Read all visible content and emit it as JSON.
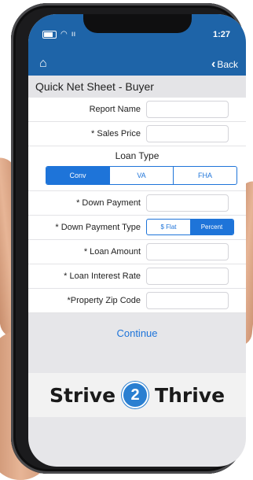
{
  "status": {
    "time": "1:27",
    "carrier": "ıı"
  },
  "nav": {
    "home_icon": "home-icon",
    "back_label": "Back"
  },
  "page": {
    "title": "Quick Net Sheet - Buyer"
  },
  "form": {
    "report_name": {
      "label": "Report Name",
      "value": ""
    },
    "sales_price": {
      "label": "* Sales Price",
      "value": ""
    },
    "loan_type": {
      "heading": "Loan Type",
      "options": [
        "Conv",
        "VA",
        "FHA"
      ],
      "selected": "Conv"
    },
    "down_payment": {
      "label": "* Down Payment",
      "value": ""
    },
    "down_payment_type": {
      "label": "* Down Payment Type",
      "options": [
        "$ Flat",
        "Percent"
      ],
      "selected": "Percent"
    },
    "loan_amount": {
      "label": "* Loan Amount",
      "value": ""
    },
    "loan_interest_rate": {
      "label": "* Loan Interest Rate",
      "value": ""
    },
    "property_zip": {
      "label": "*Property Zip Code",
      "value": ""
    }
  },
  "continue_label": "Continue",
  "banner": {
    "left": "Strive",
    "badge": "2",
    "right": "Thrive"
  },
  "colors": {
    "brand_blue": "#1e64a8",
    "accent": "#1e74d9"
  }
}
